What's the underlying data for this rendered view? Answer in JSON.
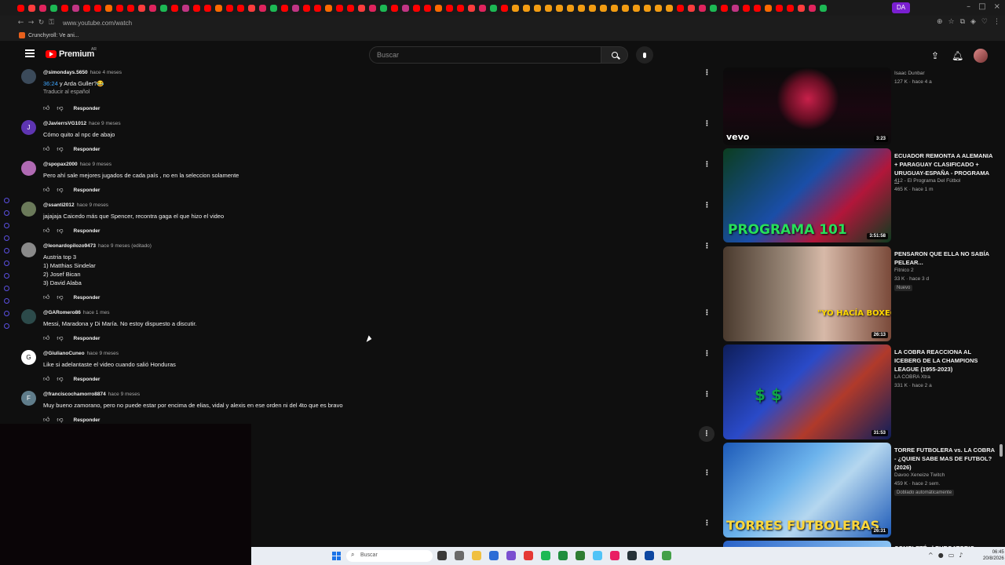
{
  "browser": {
    "url": "www.youtube.com/watch",
    "active_tab": "DA",
    "bookmark": "Crunchyroll: Ve ani..."
  },
  "header": {
    "logo": "Premium",
    "region": "AR",
    "search_placeholder": "Buscar"
  },
  "comments": [
    {
      "user": "@simondays.5650",
      "time": "hace 4 meses",
      "lines": [
        "y Arda Guller?😂"
      ],
      "link": "36:24",
      "translate": "Traducir al español",
      "avatar_color": "#3b4a5a",
      "reply": "Responder"
    },
    {
      "user": "@JavierrsVG1012",
      "time": "hace 9 meses",
      "lines": [
        "Cómo quito al npc de abajo"
      ],
      "initial": "J",
      "avatar_color": "#5e35b1",
      "reply": "Responder"
    },
    {
      "user": "@spopax2000",
      "time": "hace 9 meses",
      "lines": [
        "Pero ahí sale mejores jugados de cada país , no en la seleccion solamente"
      ],
      "avatar_color": "#b06ab3",
      "reply": "Responder"
    },
    {
      "user": "@ssanti2012",
      "time": "hace 9 meses",
      "lines": [
        "jajajaja Caicedo más que Spencer, recontra gaga el que hizo el video"
      ],
      "avatar_color": "#6b7a5a",
      "reply": "Responder"
    },
    {
      "user": "@leonardopilozo9473",
      "time": "hace 9 meses (editado)",
      "lines": [
        "Austria top 3",
        "1) Matthias Sindelar",
        "2) Josef Bican",
        "3) David Alaba"
      ],
      "avatar_color": "#8a8a8a",
      "reply": "Responder"
    },
    {
      "user": "@GARomero86",
      "time": "hace 1 mes",
      "lines": [
        "Messi, Maradona y Di María. No estoy dispuesto a discutir."
      ],
      "avatar_color": "#2c4a4a",
      "reply": "Responder"
    },
    {
      "user": "@GiulianoCuneo",
      "time": "hace 9 meses",
      "lines": [
        "Like si adelantaste el video cuando salió Honduras"
      ],
      "initial": "G",
      "avatar_color": "#ffffff",
      "reply": "Responder"
    },
    {
      "user": "@franciscochamorro8874",
      "time": "hace 9 meses",
      "lines": [
        "Muy bueno zamorano, pero no puede estar por encima de elias, vidal y alexis en ese orden ni del 4to que es bravo"
      ],
      "initial": "F",
      "avatar_color": "#607d8b",
      "reply": "Responder"
    }
  ],
  "recommendations": [
    {
      "title": "",
      "channel": "Isaac Dunbar",
      "meta": "127 K · hace 4 a",
      "duration": "3:23",
      "thumb_text": "vevo"
    },
    {
      "title": "ECUADOR REMONTA A ALEMANIA + PARAGUAY CLASIFICADO + URUGUAY-ESPAÑA - PROGRAMA ...",
      "channel": "412 - El Programa Del Fútbol",
      "meta": "465 K · hace 1 m",
      "duration": "3:51:58",
      "thumb_text": "PROGRAMA 101"
    },
    {
      "title": "PENSARON QUE ELLA NO SABÍA PELEAR...",
      "channel": "Fitnico 2",
      "meta": "33 K · hace 3 d",
      "badge": "Nuevo",
      "duration": "26:13",
      "thumb_text": "\"YO HACÍA BOXEO\""
    },
    {
      "title": "LA COBRA REACCIONA AL ICEBERG DE LA CHAMPIONS LEAGUE (1955-2023)",
      "channel": "LA COBRA Xtra",
      "meta": "331 K · hace 2 a",
      "duration": "31:53",
      "thumb_text": "$ $"
    },
    {
      "title": "TORRE FUTBOLERA vs. LA COBRA - ¿QUIEN SABE MAS DE FUTBOL? (2026)",
      "channel": "Davoo Xeneize Twitch",
      "meta": "459 K · hace 2 sem.",
      "badge": "Doblado automáticamente",
      "duration": "26:31",
      "thumb_text": "TORRES FUTBOLERAS"
    },
    {
      "title": "COMPLETÉ el PURGATORIO"
    }
  ],
  "taskbar": {
    "search": "Buscar",
    "time": "06:45",
    "date": "20/8/2026"
  }
}
